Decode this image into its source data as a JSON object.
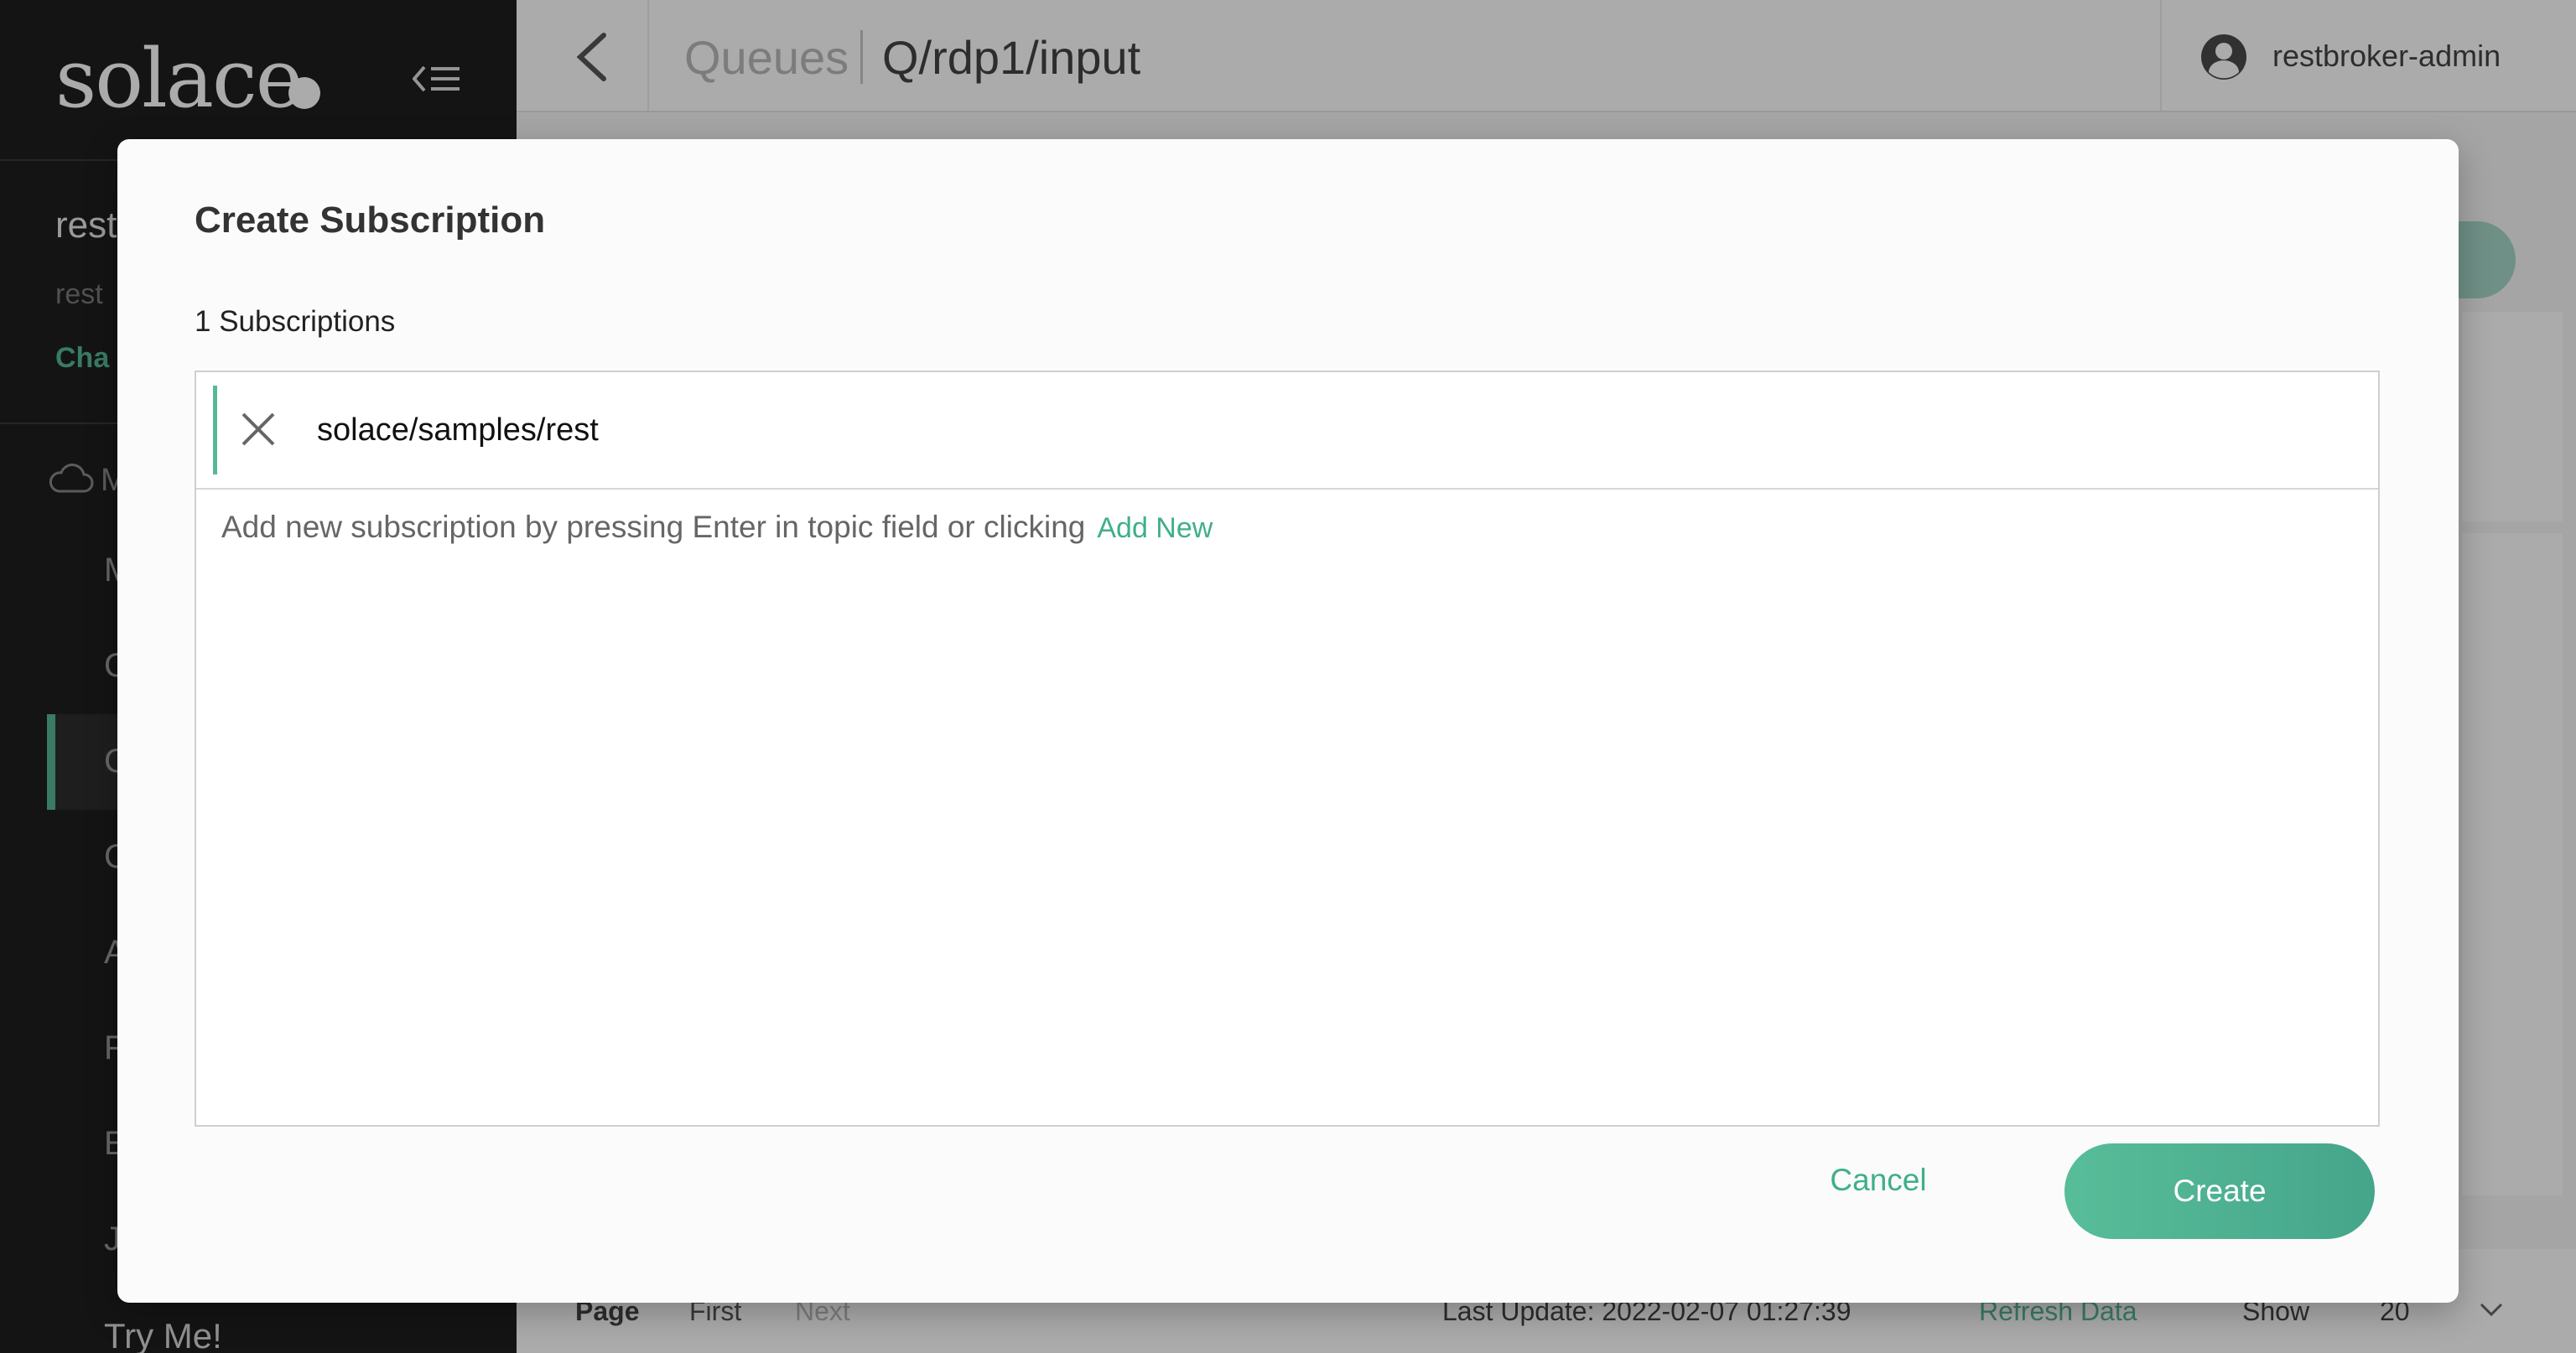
{
  "sidebar": {
    "logo_text": "solace",
    "broker_name": "rest",
    "broker_sub": "rest",
    "broker_change": "Cha",
    "section_letter": "M",
    "nav_letters": [
      "M",
      "C",
      "C",
      "C",
      "A",
      "F",
      "E",
      "J"
    ],
    "try_me": "Try Me!"
  },
  "header": {
    "breadcrumb_parent": "Queues",
    "breadcrumb_current": "Q/rdp1/input",
    "username": "restbroker-admin"
  },
  "footer": {
    "page_label": "Page",
    "first_label": "First",
    "next_label": "Next",
    "last_update": "Last Update: 2022-02-07 01:27:39",
    "refresh_label": "Refresh Data",
    "show_label": "Show",
    "show_count": "20"
  },
  "modal": {
    "title": "Create Subscription",
    "subscription_count": "1 Subscriptions",
    "subscriptions": [
      {
        "topic": "solace/samples/rest"
      }
    ],
    "hint": "Add new subscription by pressing Enter in topic field or clicking",
    "add_new_label": "Add New",
    "cancel_label": "Cancel",
    "create_label": "Create"
  },
  "colors": {
    "accent": "#56b899",
    "sidebar_bg": "#1e1e1e"
  }
}
